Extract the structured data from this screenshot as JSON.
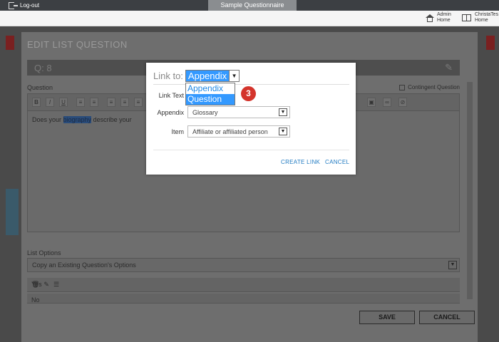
{
  "topbar": {
    "logout_label": "Log-out",
    "active_tab": "Sample Questionnaire"
  },
  "nav": {
    "admin_home_line1": "Admin",
    "admin_home_line2": "Home",
    "user_line1": "ChristaTes",
    "user_line2": "Home"
  },
  "background": {
    "title": "EDIT LIST QUESTION",
    "question_number": "Q: 8",
    "question_label": "Question",
    "contingent_label": "Contingent Question",
    "editor_text_before": "Does your ",
    "editor_text_highlight": "biography",
    "editor_text_after": " describe your",
    "list_options_label": "List Options",
    "copy_placeholder": "Copy an Existing Question's Options",
    "options": [
      "Yes",
      "No"
    ],
    "save_label": "SAVE",
    "cancel_label": "CANCEL"
  },
  "modal": {
    "link_to_label": "Link to:",
    "link_to_value": "Appendix",
    "dropdown_options": [
      "Appendix",
      "Question"
    ],
    "step_badge": "3",
    "link_text_label": "Link Text",
    "appendix_label": "Appendix",
    "appendix_value": "Glossary",
    "item_label": "Item",
    "item_value": "Affiliate or affiliated person",
    "create_link_label": "CREATE LINK",
    "cancel_label": "CANCEL"
  },
  "colors": {
    "accent": "#3399ff",
    "link": "#1f7ac2",
    "badge": "#d4342c",
    "topbar": "#3c3f43"
  }
}
